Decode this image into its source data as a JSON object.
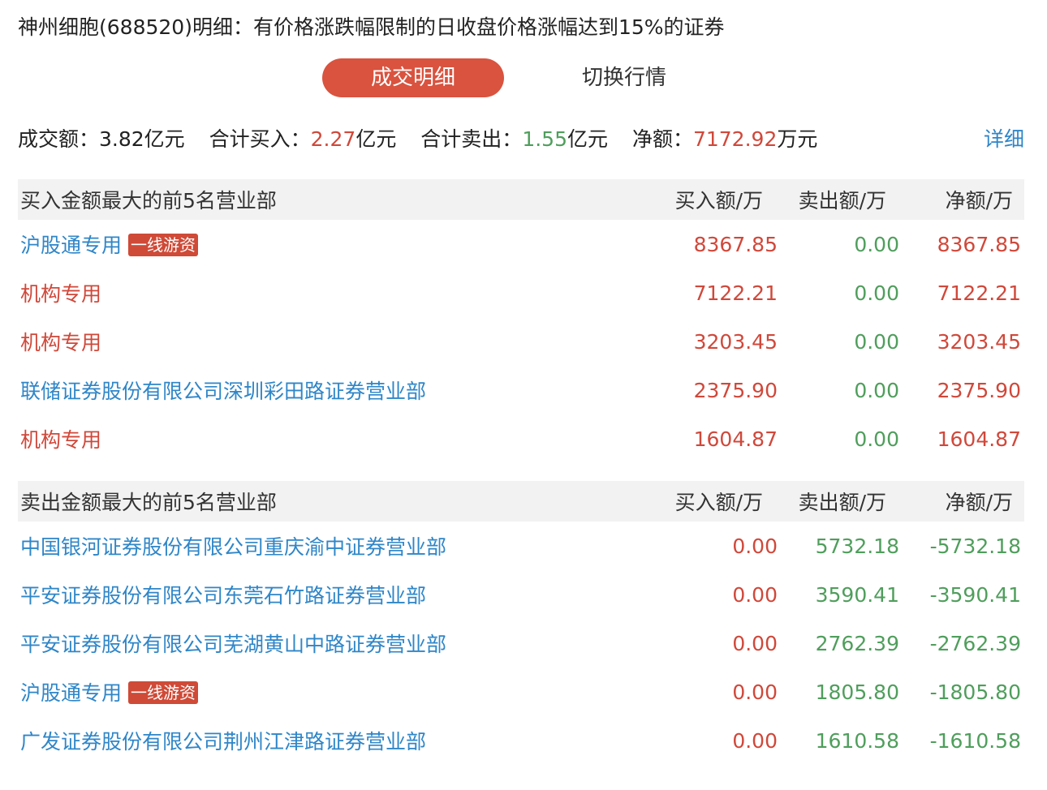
{
  "title": "神州细胞(688520)明细：有价格涨跌幅限制的日收盘价格涨幅达到15%的证券",
  "tabs": {
    "active": "成交明细",
    "inactive": "切换行情"
  },
  "summary": {
    "turnover_label": "成交额：",
    "turnover_value": "3.82亿元",
    "buy_label": "合计买入：",
    "buy_value": "2.27",
    "buy_unit": "亿元",
    "sell_label": "合计卖出：",
    "sell_value": "1.55",
    "sell_unit": "亿元",
    "net_label": "净额：",
    "net_value": "7172.92",
    "net_unit": "万元",
    "detail_link": "详细"
  },
  "buy_table": {
    "header": {
      "name": "买入金额最大的前5名营业部",
      "buy": "买入额/万",
      "sell": "卖出额/万",
      "net": "净额/万"
    },
    "rows": [
      {
        "name": "沪股通专用",
        "tag": "一线游资",
        "buy": "8367.85",
        "sell": "0.00",
        "net": "8367.85"
      },
      {
        "name": "机构专用",
        "buy": "7122.21",
        "sell": "0.00",
        "net": "7122.21"
      },
      {
        "name": "机构专用",
        "buy": "3203.45",
        "sell": "0.00",
        "net": "3203.45"
      },
      {
        "name": "联储证券股份有限公司深圳彩田路证券营业部",
        "buy": "2375.90",
        "sell": "0.00",
        "net": "2375.90"
      },
      {
        "name": "机构专用",
        "buy": "1604.87",
        "sell": "0.00",
        "net": "1604.87"
      }
    ]
  },
  "sell_table": {
    "header": {
      "name": "卖出金额最大的前5名营业部",
      "buy": "买入额/万",
      "sell": "卖出额/万",
      "net": "净额/万"
    },
    "rows": [
      {
        "name": "中国银河证券股份有限公司重庆渝中证券营业部",
        "buy": "0.00",
        "sell": "5732.18",
        "net": "-5732.18"
      },
      {
        "name": "平安证券股份有限公司东莞石竹路证券营业部",
        "buy": "0.00",
        "sell": "3590.41",
        "net": "-3590.41"
      },
      {
        "name": "平安证券股份有限公司芜湖黄山中路证券营业部",
        "buy": "0.00",
        "sell": "2762.39",
        "net": "-2762.39"
      },
      {
        "name": "沪股通专用",
        "tag": "一线游资",
        "buy": "0.00",
        "sell": "1805.80",
        "net": "-1805.80"
      },
      {
        "name": "广发证券股份有限公司荆州江津路证券营业部",
        "buy": "0.00",
        "sell": "1610.58",
        "net": "-1610.58"
      }
    ]
  },
  "colors": {
    "accent": "#d9533f",
    "up": "#d0483a",
    "down": "#4f9e5c",
    "link": "#2f86c8",
    "header_bg": "#f2f2f2"
  }
}
